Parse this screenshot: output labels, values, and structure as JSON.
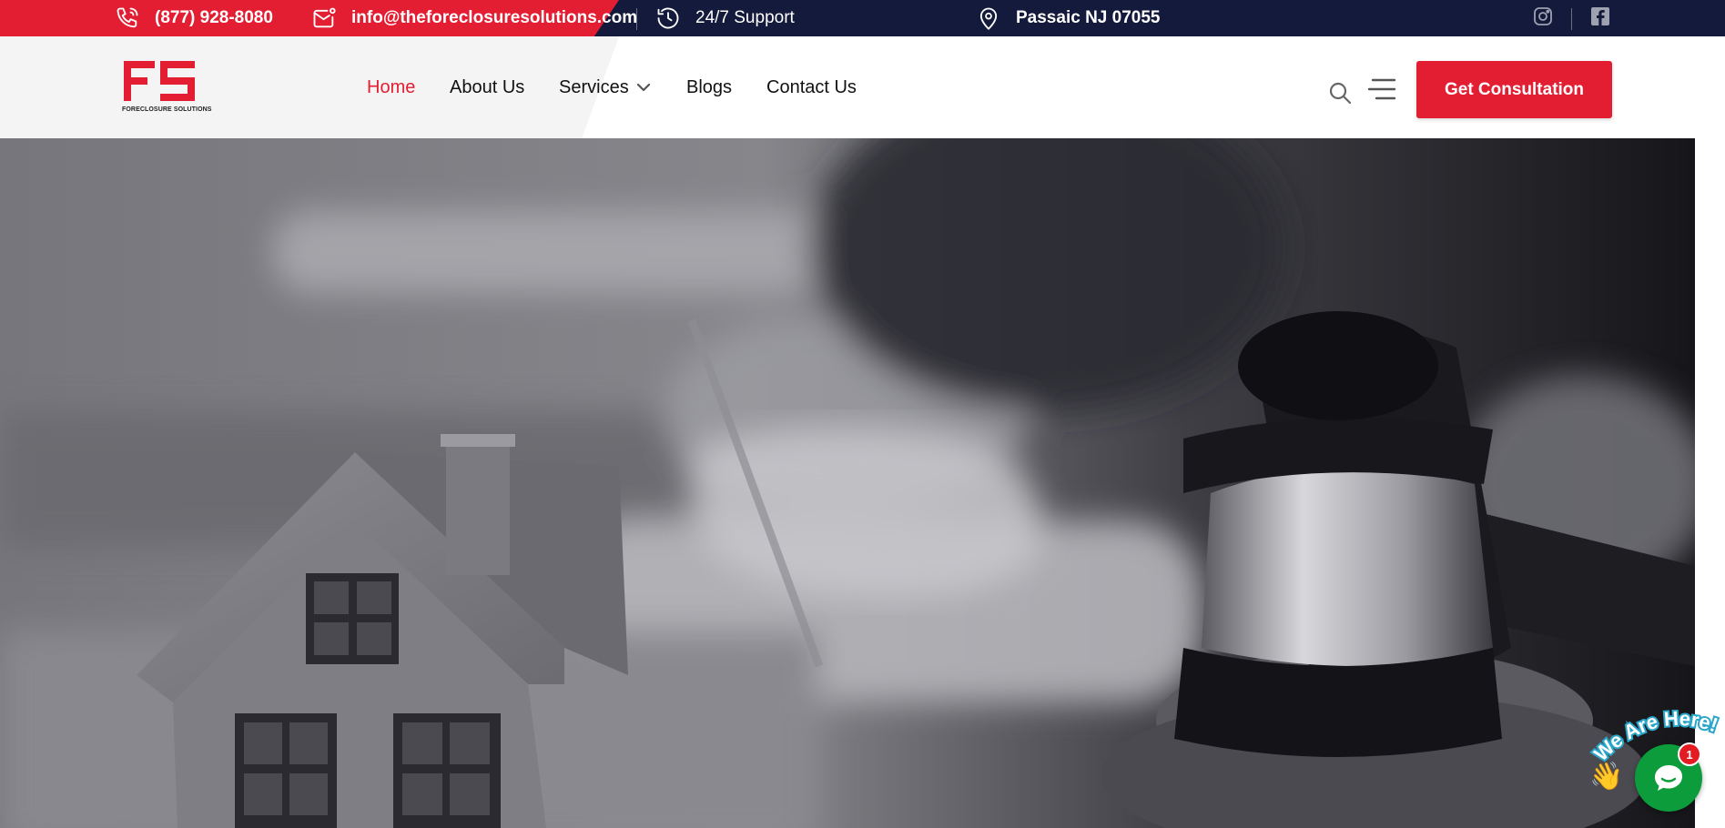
{
  "topbar": {
    "phone": "(877) 928-8080",
    "email": "info@theforeclosuresolutions.com",
    "support": "24/7 Support",
    "location": "Passaic NJ 07055",
    "social": [
      "instagram-icon",
      "facebook-icon"
    ]
  },
  "logo": {
    "mark": "FS",
    "subtitle": "FORECLOSURE SOLUTIONS"
  },
  "nav": {
    "items": [
      {
        "label": "Home",
        "active": true
      },
      {
        "label": "About Us"
      },
      {
        "label": "Services",
        "has_dropdown": true
      },
      {
        "label": "Blogs"
      },
      {
        "label": "Contact Us"
      }
    ]
  },
  "header": {
    "cta_label": "Get Consultation"
  },
  "widget": {
    "badge_text": "We Are Here!",
    "unread_count": "1"
  },
  "colors": {
    "brand_red": "#e41e32",
    "topbar_navy": "#141a3b",
    "chat_green": "#0c9c3c"
  }
}
